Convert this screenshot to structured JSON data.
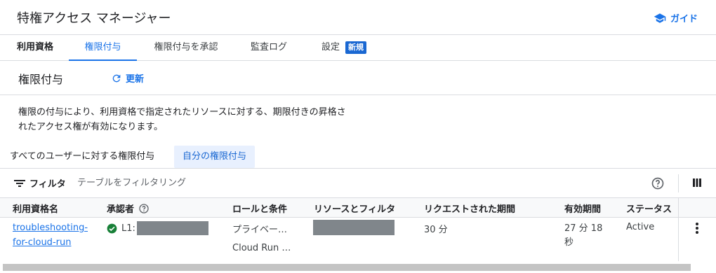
{
  "header": {
    "title": "特権アクセス マネージャー",
    "guide_label": "ガイド"
  },
  "tabs": [
    {
      "label": "利用資格"
    },
    {
      "label": "権限付与"
    },
    {
      "label": "権限付与を承認"
    },
    {
      "label": "監査ログ"
    },
    {
      "label": "設定",
      "badge": "新規"
    }
  ],
  "section": {
    "title": "権限付与",
    "refresh_label": "更新"
  },
  "description": "権限の付与により、利用資格で指定されたリソースに対する、期限付きの昇格さ\nれたアクセス権が有効になります。",
  "scope": {
    "all_label": "すべてのユーザーに対する権限付与",
    "mine_label": "自分の権限付与"
  },
  "filter": {
    "label": "フィルタ",
    "placeholder": "テーブルをフィルタリング"
  },
  "table": {
    "columns": [
      "利用資格名",
      "承認者",
      "ロールと条件",
      "リソースとフィルタ",
      "リクエストされた期間",
      "有効期間",
      "ステータス"
    ],
    "rows": [
      {
        "entitlement_line1": "troubleshooting-",
        "entitlement_line2": "for-cloud-run",
        "approver_prefix": "L1:",
        "role_line1": "プライベー…",
        "role_line2": "Cloud Run …",
        "requested_duration": "30 分",
        "active_line1": "27 分 18",
        "active_line2": "秒",
        "status": "Active"
      }
    ]
  },
  "colors": {
    "accent": "#1a73e8",
    "badge": "#1967d2",
    "success": "#188038",
    "redact": "#80868b"
  }
}
